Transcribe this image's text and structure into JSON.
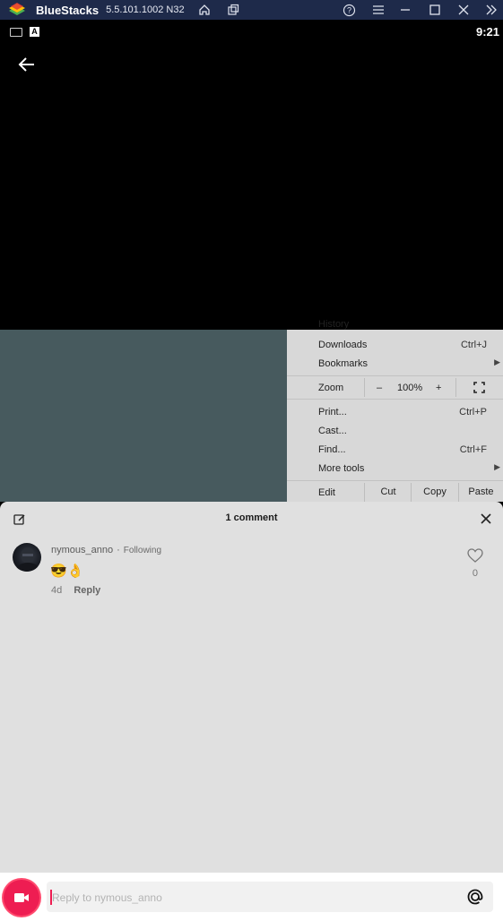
{
  "titlebar": {
    "app_name": "BlueStacks",
    "version": "5.5.101.1002 N32"
  },
  "statusbar": {
    "keyboard_letter": "A",
    "time": "9:21"
  },
  "context_menu": {
    "partial_item": "History",
    "items": [
      {
        "label": "Downloads",
        "shortcut": "Ctrl+J"
      },
      {
        "label": "Bookmarks",
        "has_submenu": true
      }
    ],
    "zoom": {
      "label": "Zoom",
      "minus": "–",
      "value": "100%",
      "plus": "+"
    },
    "items2": [
      {
        "label": "Print...",
        "shortcut": "Ctrl+P"
      },
      {
        "label": "Cast..."
      },
      {
        "label": "Find...",
        "shortcut": "Ctrl+F"
      },
      {
        "label": "More tools",
        "has_submenu": true
      }
    ],
    "edit_row": {
      "label": "Edit",
      "cut": "Cut",
      "copy": "Copy",
      "paste": "Paste"
    }
  },
  "comments": {
    "header": "1 comment",
    "items": [
      {
        "username": "nymous_anno",
        "separator": "·",
        "relation": "Following",
        "text": "😎👌",
        "age": "4d",
        "reply_label": "Reply",
        "likes": "0"
      }
    ]
  },
  "composer": {
    "placeholder": "Reply to nymous_anno"
  },
  "colors": {
    "accent": "#ee1d52",
    "titlebar": "#1e2a4a",
    "desktop": "#475a5e"
  }
}
